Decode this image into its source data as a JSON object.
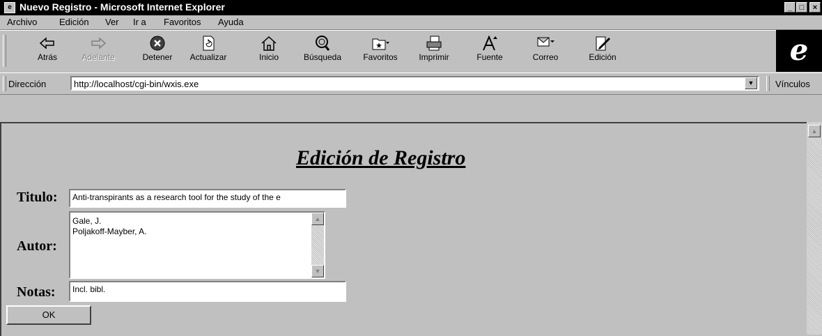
{
  "window": {
    "title": "Nuevo Registro - Microsoft Internet Explorer",
    "controls": {
      "minimize": "_",
      "maximize": "□",
      "close": "×"
    }
  },
  "menu": [
    "Archivo",
    "Edición",
    "Ver",
    "Ir a",
    "Favoritos",
    "Ayuda"
  ],
  "toolbar": {
    "back": "Atrás",
    "forward": "Adelante",
    "stop": "Detener",
    "refresh": "Actualizar",
    "home": "Inicio",
    "search": "Búsqueda",
    "favorites": "Favoritos",
    "print": "Imprimir",
    "font": "Fuente",
    "mail": "Correo",
    "edit": "Edición"
  },
  "address": {
    "label": "Dirección",
    "url": "http://localhost/cgi-bin/wxis.exe",
    "links_label": "Vínculos"
  },
  "page": {
    "title": "Edición de Registro",
    "fields": {
      "titulo_label": "Titulo:",
      "titulo_value": "Anti-transpirants as a research tool for the study of the e",
      "autor_label": "Autor:",
      "autor_lines": [
        "Gale, J.",
        "Poljakoff-Mayber, A."
      ],
      "notas_label": "Notas:",
      "notas_value": "Incl. bibl."
    },
    "ok_label": "OK"
  },
  "colors": {
    "chrome": "#c0c0c0",
    "titlebar": "#000000",
    "field": "#ffffff"
  },
  "icons": {
    "back": "arrow-left-icon",
    "forward": "arrow-right-icon",
    "stop": "stop-icon",
    "refresh": "refresh-icon",
    "home": "home-icon",
    "search": "search-icon",
    "favorites": "favorites-icon",
    "print": "print-icon",
    "font": "font-icon",
    "mail": "mail-icon",
    "edit": "edit-icon"
  }
}
